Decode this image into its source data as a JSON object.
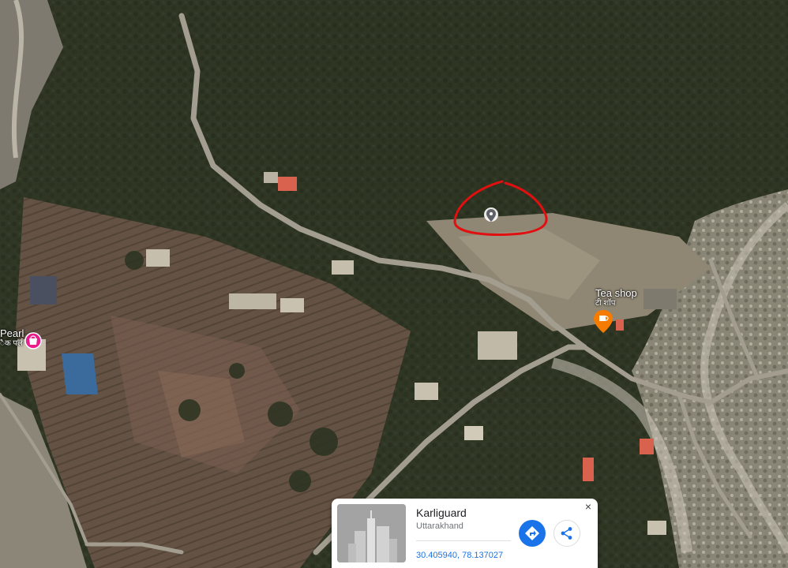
{
  "map": {
    "type": "satellite",
    "selected_area_marker": "pin-icon"
  },
  "pois": {
    "left": {
      "name": "Pearl",
      "name_local": "ैक पर्ल",
      "icon": "shopping-icon",
      "color": "#e91e8c"
    },
    "tea": {
      "name": "Tea shop",
      "name_local": "टी शॉप",
      "icon": "coffee-cup-icon",
      "color": "#f57c00"
    }
  },
  "info_card": {
    "title": "Karliguard",
    "subtitle": "Uttarakhand",
    "coordinates": "30.405940, 78.137027",
    "close_label": "×",
    "directions_icon": "directions-icon",
    "share_icon": "share-icon",
    "accent": "#1a73e8"
  },
  "annotation": {
    "color": "#e01010"
  }
}
